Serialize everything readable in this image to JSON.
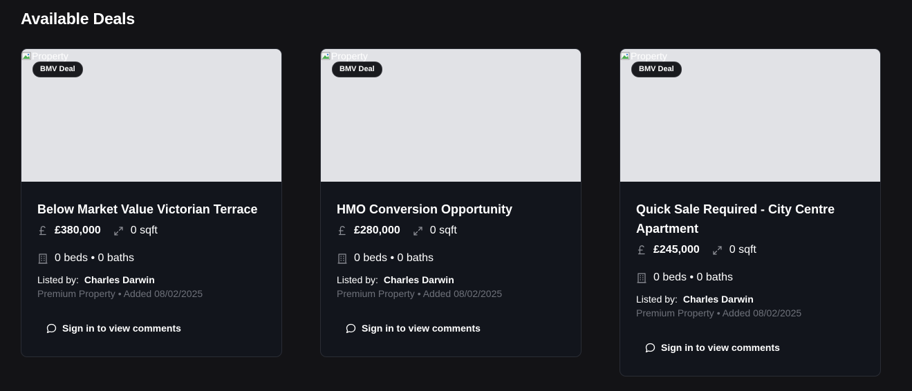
{
  "page": {
    "title": "Available Deals"
  },
  "deals": [
    {
      "image_alt": "Property",
      "badge": "BMV Deal",
      "title": "Below Market Value Victorian Terrace",
      "price": "£380,000",
      "area": "0 sqft",
      "rooms": "0 beds • 0 baths",
      "listed_by_label": "Listed by:",
      "listed_by_name": "Charles Darwin",
      "sub_info": "Premium Property • Added 08/02/2025",
      "comments_label": "Sign in to view comments"
    },
    {
      "image_alt": "Property",
      "badge": "BMV Deal",
      "title": "HMO Conversion Opportunity",
      "price": "£280,000",
      "area": "0 sqft",
      "rooms": "0 beds • 0 baths",
      "listed_by_label": "Listed by:",
      "listed_by_name": "Charles Darwin",
      "sub_info": "Premium Property • Added 08/02/2025",
      "comments_label": "Sign in to view comments"
    },
    {
      "image_alt": "Property",
      "badge": "BMV Deal",
      "title": "Quick Sale Required - City Centre Apartment",
      "price": "£245,000",
      "area": "0 sqft",
      "rooms": "0 beds • 0 baths",
      "listed_by_label": "Listed by:",
      "listed_by_name": "Charles Darwin",
      "sub_info": "Premium Property • Added 08/02/2025",
      "comments_label": "Sign in to view comments"
    }
  ],
  "icons": {
    "price": "pound-icon",
    "area": "expand-arrows-icon",
    "rooms": "building-icon",
    "comments": "chat-bubble-icon",
    "image": "broken-image-icon"
  },
  "colors": {
    "background": "#131316",
    "card": "#12151c",
    "image_placeholder": "#e1e2e6",
    "muted_text": "#6e717a"
  }
}
